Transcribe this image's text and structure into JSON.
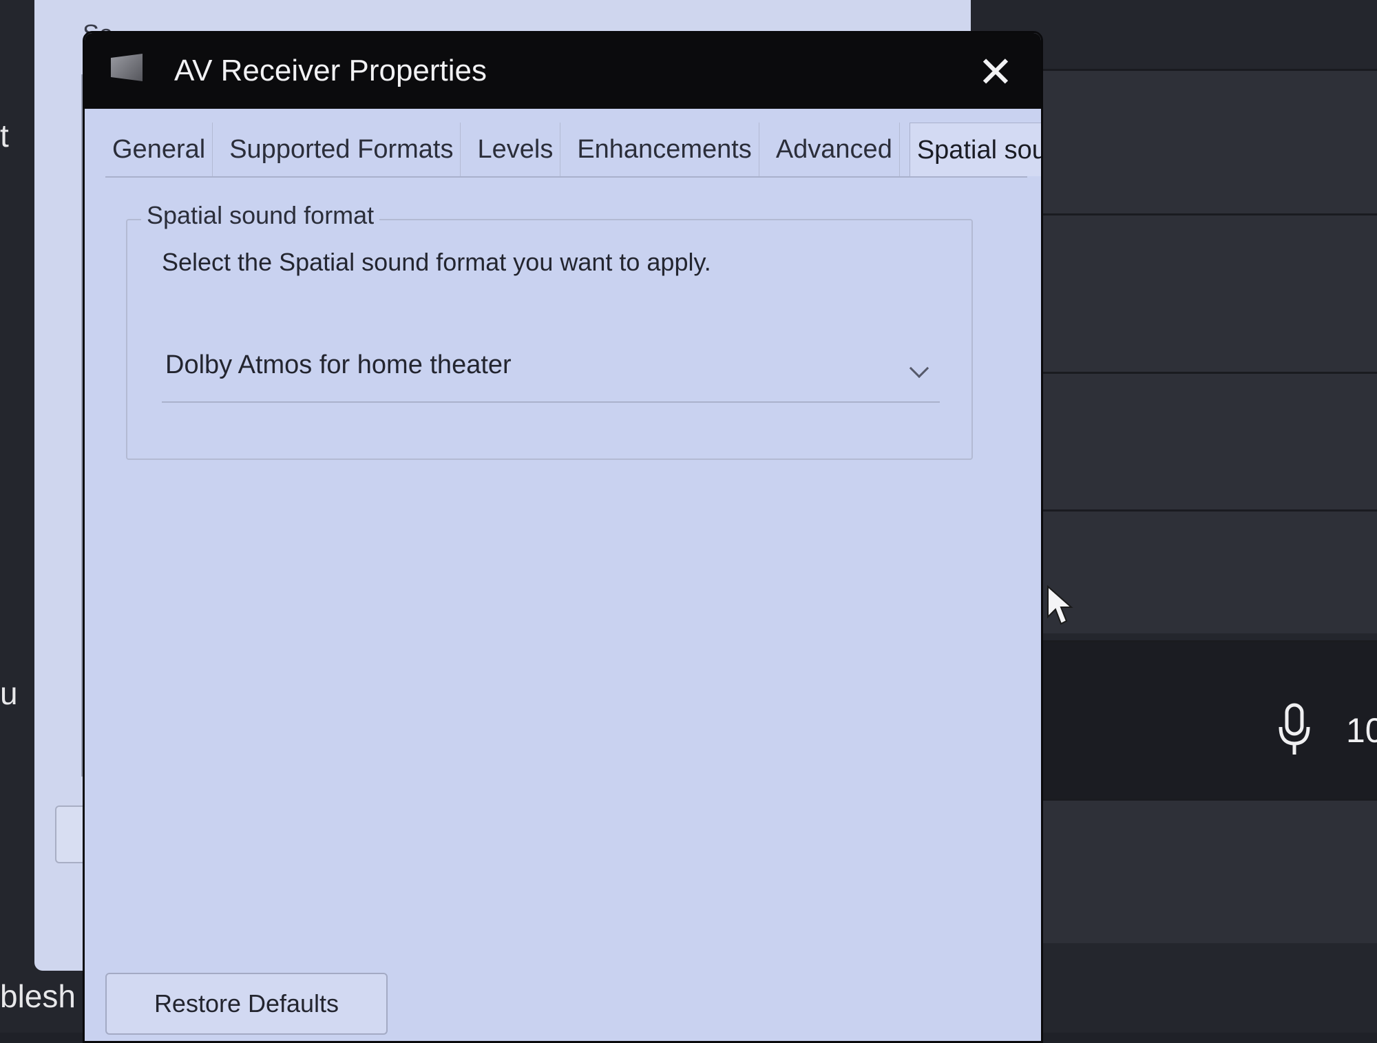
{
  "background": {
    "left_fragment_top": "t",
    "left_fragment_mid": "u",
    "left_fragment_bottom": "blesh",
    "right_number": "10"
  },
  "back_dialog": {
    "title_fragment": "Se"
  },
  "dialog": {
    "title": "AV Receiver Properties",
    "close_label": "✕",
    "tabs": [
      {
        "label": "General"
      },
      {
        "label": "Supported Formats"
      },
      {
        "label": "Levels"
      },
      {
        "label": "Enhancements"
      },
      {
        "label": "Advanced"
      },
      {
        "label": "Spatial sound"
      }
    ],
    "active_tab": "Spatial sound",
    "spatial_group": {
      "label": "Spatial sound format",
      "description": "Select the Spatial sound format you want to apply.",
      "selected_format": "Dolby Atmos for home theater"
    },
    "restore_defaults_label": "Restore Defaults"
  }
}
